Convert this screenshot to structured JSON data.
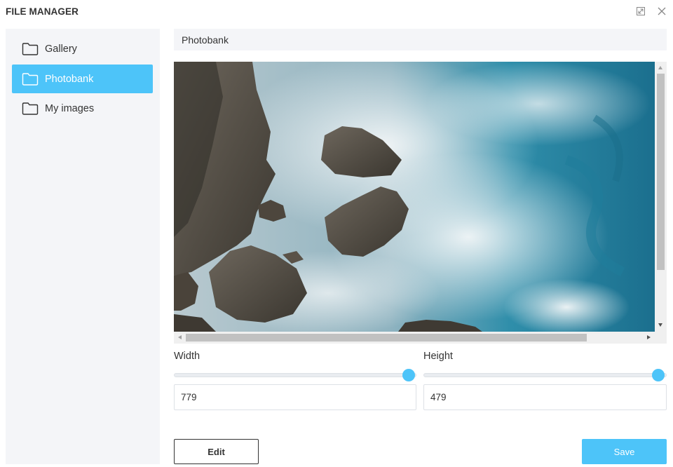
{
  "window": {
    "title": "FILE MANAGER",
    "expand_icon": "expand-icon",
    "close_icon": "close-icon"
  },
  "sidebar": {
    "items": [
      {
        "label": "Gallery",
        "icon": "folder-icon",
        "active": false
      },
      {
        "label": "Photobank",
        "icon": "folder-icon",
        "active": true
      },
      {
        "label": "My images",
        "icon": "folder-icon",
        "active": false
      }
    ]
  },
  "path": {
    "current": "Photobank"
  },
  "dimensions": {
    "width_label": "Width",
    "height_label": "Height",
    "width_value": "779",
    "height_value": "479",
    "width_slider_level": 1.0,
    "height_slider_level": 1.0
  },
  "actions": {
    "edit_label": "Edit",
    "save_label": "Save"
  },
  "colors": {
    "accent": "#4dc4f9",
    "panel": "#f4f5f8",
    "text": "#333333"
  }
}
